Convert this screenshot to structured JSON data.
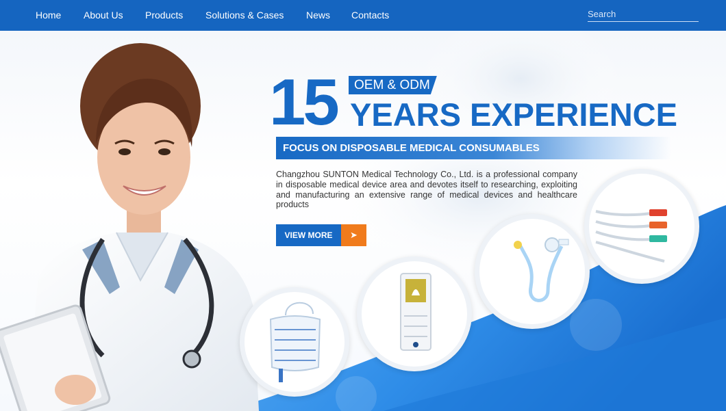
{
  "nav": {
    "items": [
      {
        "label": "Home"
      },
      {
        "label": "About Us"
      },
      {
        "label": "Products"
      },
      {
        "label": "Solutions & Cases"
      },
      {
        "label": "News"
      },
      {
        "label": "Contacts"
      }
    ],
    "search_placeholder": "Search"
  },
  "hero": {
    "number": "15",
    "badge": "OEM & ODM",
    "headline": "YEARS EXPERIENCE",
    "focus": "FOCUS ON DISPOSABLE MEDICAL CONSUMABLES",
    "description": "Changzhou SUNTON Medical Technology Co., Ltd. is a professional company in disposable medical device area and devotes itself to researching, exploiting and manufacturing an extensive range of medical devices and healthcare products",
    "button_label": "VIEW MORE",
    "button_arrow_icon": "arrow-right-icon"
  },
  "colors": {
    "primary": "#1769c4",
    "accent": "#f07b1c"
  }
}
